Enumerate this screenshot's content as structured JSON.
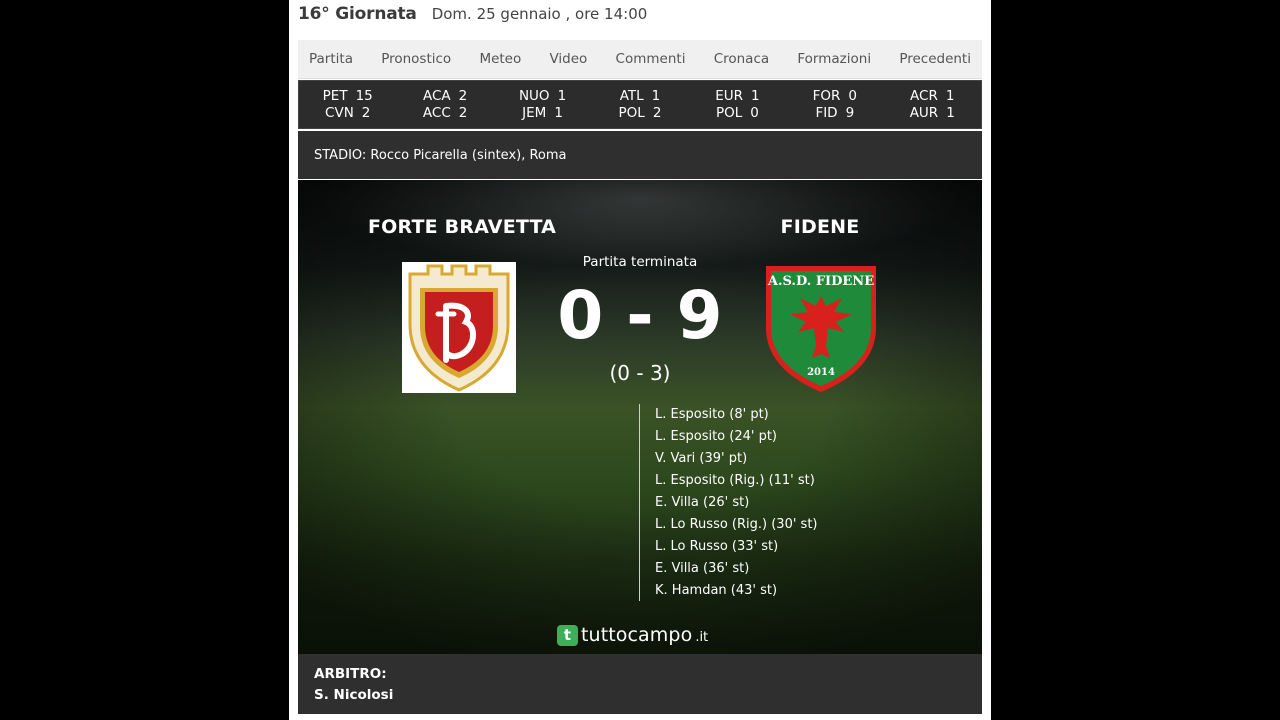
{
  "header": {
    "round": "16° Giornata",
    "date": "Dom. 25 gennaio , ore 14:00"
  },
  "tabs": [
    "Partita",
    "Pronostico",
    "Meteo",
    "Video",
    "Commenti",
    "Cronaca",
    "Formazioni",
    "Precedenti"
  ],
  "ticker": [
    {
      "home": "PET",
      "home_score": "15",
      "away": "CVN",
      "away_score": "2"
    },
    {
      "home": "ACA",
      "home_score": "2",
      "away": "ACC",
      "away_score": "2"
    },
    {
      "home": "NUO",
      "home_score": "1",
      "away": "JEM",
      "away_score": "1"
    },
    {
      "home": "ATL",
      "home_score": "1",
      "away": "POL",
      "away_score": "2"
    },
    {
      "home": "EUR",
      "home_score": "1",
      "away": "POL",
      "away_score": "0"
    },
    {
      "home": "FOR",
      "home_score": "0",
      "away": "FID",
      "away_score": "9"
    },
    {
      "home": "ACR",
      "home_score": "1",
      "away": "AUR",
      "away_score": "1"
    }
  ],
  "stadium": "STADIO: Rocco Picarella (sintex), Roma",
  "match": {
    "home_team": "FORTE BRAVETTA",
    "away_team": "FIDENE",
    "status": "Partita terminata",
    "score": "0 - 9",
    "halftime": "(0 - 3)",
    "home_crest_icon": "forte-bravetta-crest",
    "away_crest_icon": "fidene-crest",
    "away_crest_text": "A.S.D. FIDENE",
    "away_crest_year": "2014",
    "scorers": [
      "L. Esposito (8' pt)",
      "L. Esposito (24' pt)",
      "V. Vari (39' pt)",
      "L. Esposito (Rig.) (11' st)",
      "E. Villa (26' st)",
      "L. Lo Russo (Rig.) (30' st)",
      "L. Lo Russo (33' st)",
      "E. Villa (36' st)",
      "K. Hamdan (43' st)"
    ]
  },
  "brand": {
    "icon": "t",
    "name": "tuttocampo",
    "tld": ".it"
  },
  "referee": {
    "label": "ARBITRO:",
    "name": "S. Nicolosi"
  },
  "colors": {
    "ticker_bg": "#2c2c2c",
    "panel_bg": "#2f2f2f",
    "brand_green": "#3fae5a",
    "fidene_green": "#1f8a3a",
    "fidene_red": "#d8201c",
    "bravetta_red": "#c41e1e",
    "bravetta_gold": "#d9a830"
  }
}
